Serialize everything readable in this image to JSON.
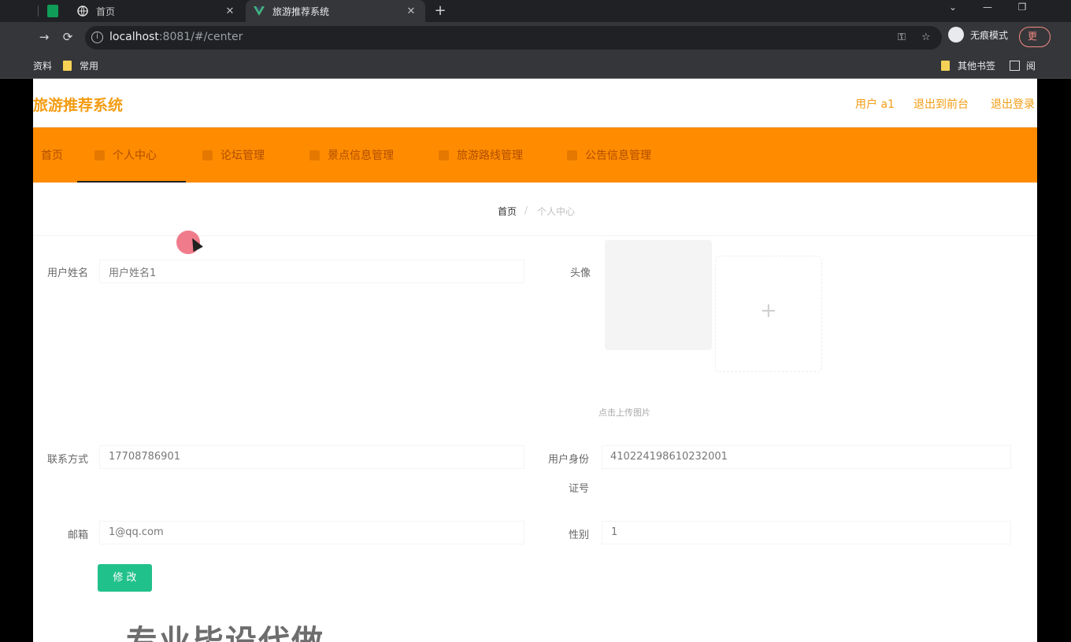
{
  "browser": {
    "tabs": [
      {
        "title": "首页",
        "favicon": "globe-icon"
      },
      {
        "title": "旅游推荐系统",
        "favicon": "vue-icon"
      }
    ],
    "url_host": "localhost",
    "url_rest": ":8081/#/center",
    "incognito_label": "无痕模式",
    "update_label": "更",
    "bookmarks": [
      {
        "label": "资料"
      },
      {
        "label": "常用"
      }
    ],
    "bookmarks_right": [
      {
        "label": "其他书签"
      },
      {
        "label": "阅"
      }
    ]
  },
  "site": {
    "title": "旅游推荐系统",
    "header_links": [
      "用户 a1",
      "退出到前台",
      "退出登录"
    ],
    "accent": "#ff8c00",
    "title_color": "#f39c12"
  },
  "nav": [
    {
      "label": "首页"
    },
    {
      "label": "个人中心"
    },
    {
      "label": "论坛管理"
    },
    {
      "label": "景点信息管理"
    },
    {
      "label": "旅游路线管理"
    },
    {
      "label": "公告信息管理"
    }
  ],
  "breadcrumb": {
    "home": "首页",
    "separator": "/",
    "current": "个人中心"
  },
  "form": {
    "username_label": "用户姓名",
    "username_value": "用户姓名1",
    "avatar_label": "头像",
    "upload_tip": "点击上传图片",
    "phone_label": "联系方式",
    "phone_value": "17708786901",
    "idcard_label_line1": "用户身份",
    "idcard_label_line2": "证号",
    "idcard_value": "410224198610232001",
    "email_label": "邮箱",
    "email_value": "1@qq.com",
    "gender_label": "性别",
    "gender_value": "1",
    "save_label": "修 改",
    "save_color": "#21c18c"
  },
  "overlay": {
    "watermark": "专业毕设代做"
  }
}
